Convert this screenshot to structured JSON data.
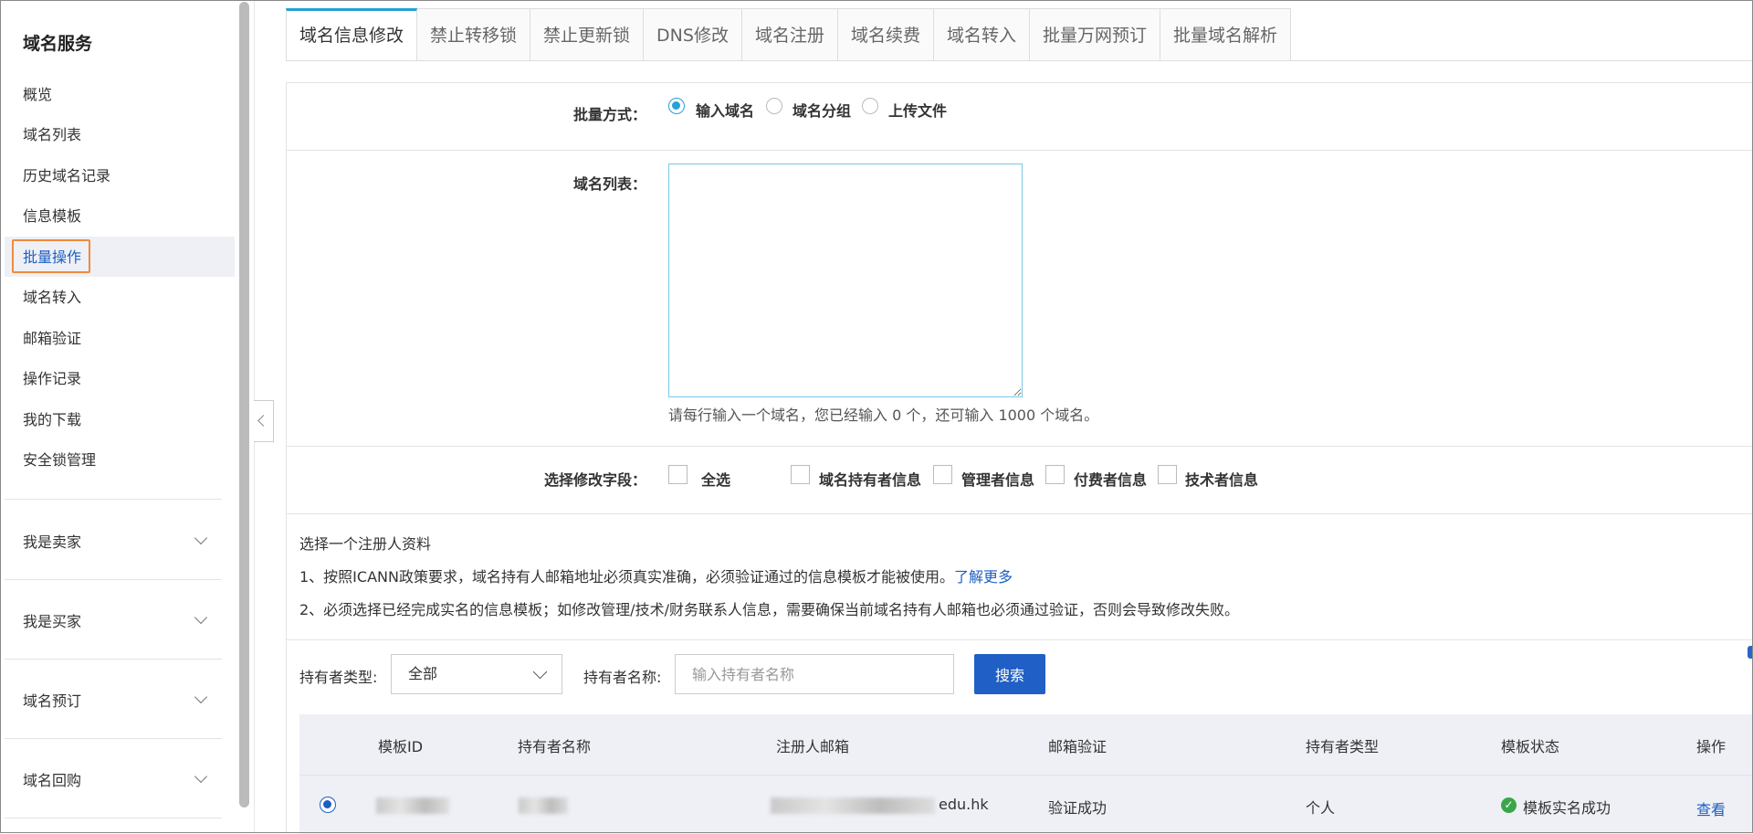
{
  "sidebar": {
    "title": "域名服务",
    "items": [
      {
        "label": "概览"
      },
      {
        "label": "域名列表"
      },
      {
        "label": "历史域名记录"
      },
      {
        "label": "信息模板"
      },
      {
        "label": "批量操作",
        "active": true
      },
      {
        "label": "域名转入"
      },
      {
        "label": "邮箱验证"
      },
      {
        "label": "操作记录"
      },
      {
        "label": "我的下载"
      },
      {
        "label": "安全锁管理"
      }
    ],
    "groups": [
      {
        "label": "我是卖家"
      },
      {
        "label": "我是买家"
      },
      {
        "label": "域名预订"
      },
      {
        "label": "域名回购"
      }
    ]
  },
  "tabs": [
    {
      "label": "域名信息修改",
      "active": true
    },
    {
      "label": "禁止转移锁"
    },
    {
      "label": "禁止更新锁"
    },
    {
      "label": "DNS修改"
    },
    {
      "label": "域名注册"
    },
    {
      "label": "域名续费"
    },
    {
      "label": "域名转入"
    },
    {
      "label": "批量万网预订"
    },
    {
      "label": "批量域名解析"
    }
  ],
  "form": {
    "batch_mode_label": "批量方式：",
    "batch_mode_options": [
      {
        "label": "输入域名",
        "selected": true
      },
      {
        "label": "域名分组"
      },
      {
        "label": "上传文件"
      }
    ],
    "domain_list_label": "域名列表：",
    "domain_list_value": "",
    "domain_list_hint": "请每行输入一个域名，您已经输入 0 个，还可输入 1000 个域名。",
    "fields_label": "选择修改字段：",
    "fields_options": [
      {
        "label": "全选"
      },
      {
        "label": "域名持有者信息"
      },
      {
        "label": "管理者信息"
      },
      {
        "label": "付费者信息"
      },
      {
        "label": "技术者信息"
      }
    ]
  },
  "registrant": {
    "heading": "选择一个注册人资料",
    "note1": "1、按照ICANN政策要求，域名持有人邮箱地址必须真实准确，必须验证通过的信息模板才能被使用。",
    "note1_link": "了解更多",
    "note2": "2、必须选择已经完成实名的信息模板；如修改管理/技术/财务联系人信息，需要确保当前域名持有人邮箱也必须通过验证，否则会导致修改失败。"
  },
  "filters": {
    "holder_type_label": "持有者类型:",
    "holder_type_value": "全部",
    "holder_name_label": "持有者名称:",
    "holder_name_placeholder": "输入持有者名称",
    "holder_name_value": "",
    "search_label": "搜索"
  },
  "table": {
    "columns": [
      "模板ID",
      "持有者名称",
      "注册人邮箱",
      "邮箱验证",
      "持有者类型",
      "模板状态",
      "操作"
    ],
    "rows": [
      {
        "selected": true,
        "email_suffix": "edu.hk",
        "email_verify": "验证成功",
        "holder_type": "个人",
        "status": "模板实名成功",
        "action": "查看"
      }
    ]
  },
  "colors": {
    "accent": "#25a0d8",
    "primary_button": "#1f5fc6",
    "link": "#1d5fc0",
    "highlight_box": "#f08a3c",
    "success": "#3aa64a"
  }
}
